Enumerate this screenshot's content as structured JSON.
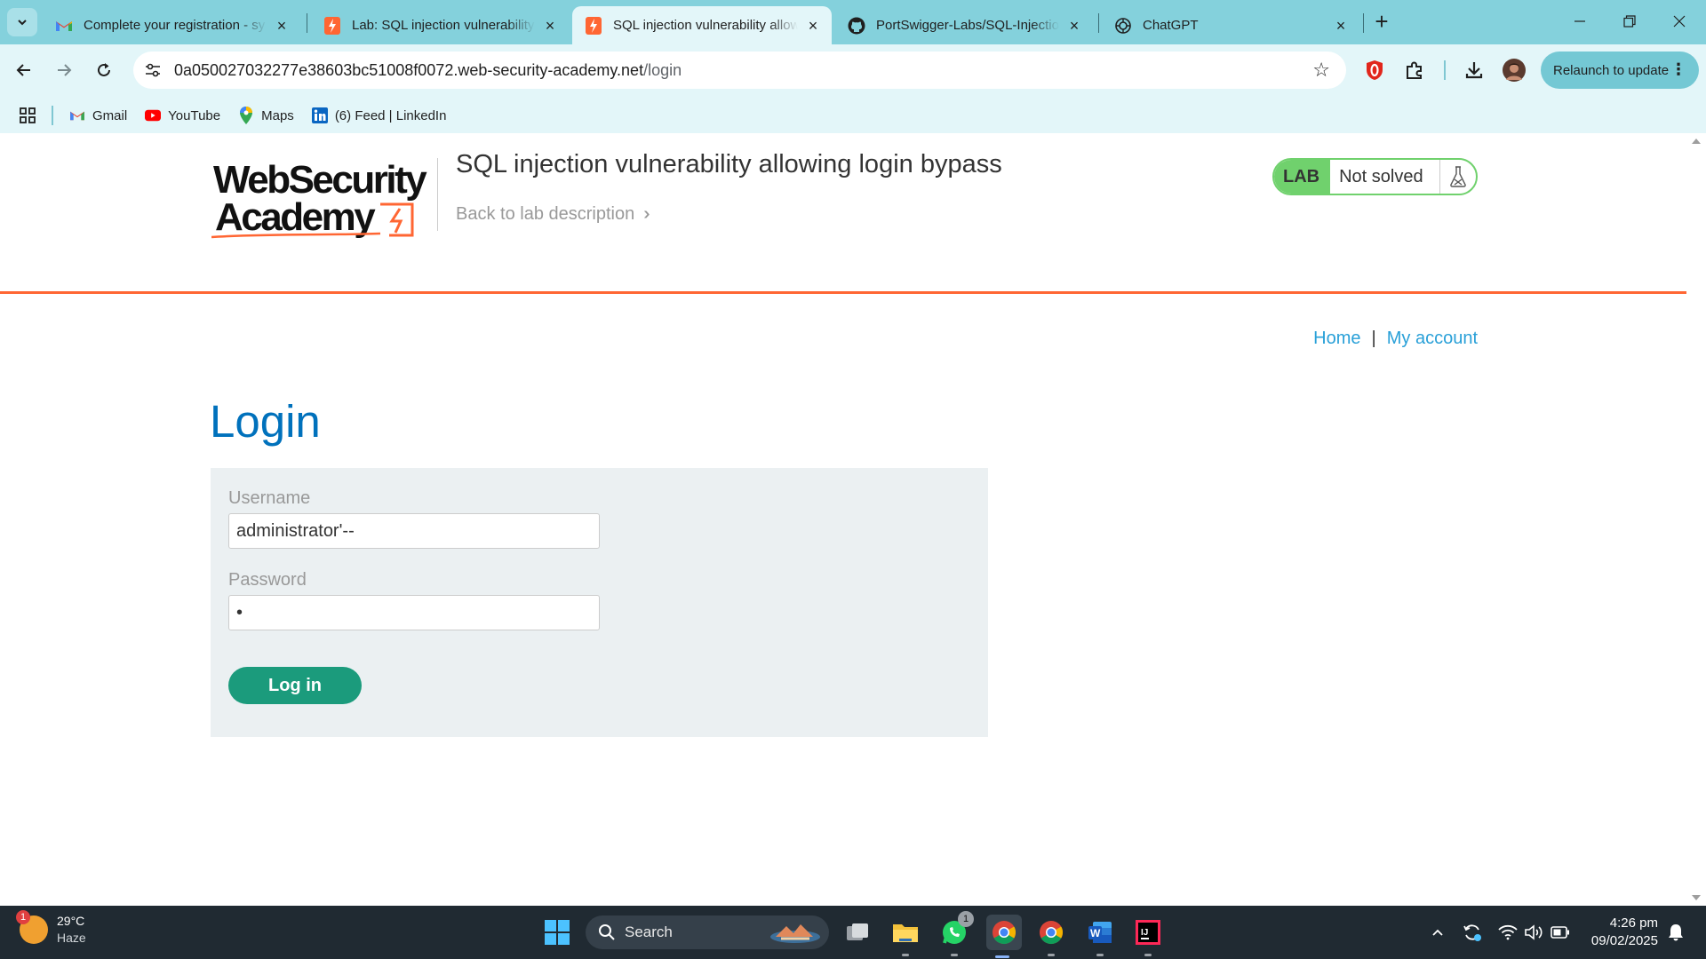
{
  "browser": {
    "tabs": [
      {
        "title": "Complete your registration - sy",
        "favicon": "gmail-icon",
        "active": false
      },
      {
        "title": "Lab: SQL injection vulnerability",
        "favicon": "portswigger-icon",
        "active": false
      },
      {
        "title": "SQL injection vulnerability allow",
        "favicon": "portswigger-icon",
        "active": true
      },
      {
        "title": "PortSwigger-Labs/SQL-Injection",
        "favicon": "github-icon",
        "active": false
      },
      {
        "title": "ChatGPT",
        "favicon": "chatgpt-icon",
        "active": false
      }
    ],
    "address": {
      "host": "0a050027032277e38603bc51008f0072.web-security-academy.net",
      "path": "/login"
    },
    "relaunch_label": "Relaunch to update",
    "bookmarks": [
      {
        "label": "Gmail",
        "icon": "gmail-icon"
      },
      {
        "label": "YouTube",
        "icon": "youtube-icon"
      },
      {
        "label": "Maps",
        "icon": "maps-icon"
      },
      {
        "label": "(6) Feed | LinkedIn",
        "icon": "linkedin-icon"
      }
    ]
  },
  "header": {
    "logo_line1": "WebSecurity",
    "logo_line2": "Academy",
    "lab_title": "SQL injection vulnerability allowing login bypass",
    "back_link": "Back to lab description",
    "lab_badge": "LAB",
    "lab_status": "Not solved"
  },
  "nav": {
    "home": "Home",
    "separator": "|",
    "my_account": "My account"
  },
  "login": {
    "heading": "Login",
    "username_label": "Username",
    "username_value": "administrator'--",
    "password_label": "Password",
    "password_value": "•",
    "submit_label": "Log in"
  },
  "taskbar": {
    "weather_temp": "29°C",
    "weather_desc": "Haze",
    "weather_badge": "1",
    "search_placeholder": "Search",
    "whatsapp_badge": "1",
    "time": "4:26 pm",
    "date": "09/02/2025"
  },
  "colors": {
    "chrome_tabbar": "#84d1dc",
    "chrome_toolbar": "#e3f6f9",
    "academy_orange": "#ff6633",
    "login_heading": "#0071bc",
    "link": "#29a0d8",
    "button": "#1b9b7c",
    "lab_green": "#70d16d"
  }
}
